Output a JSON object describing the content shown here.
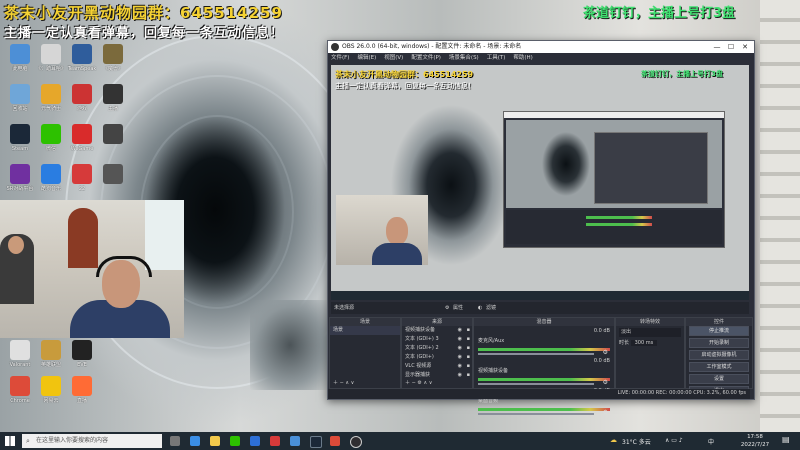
{
  "stream_overlay": {
    "line1": "茶末小友开黑动物园群：645514259",
    "line2": "主播一定认真看弹幕，回复每一条互动信息！",
    "top_right": "茶道钉钉，主播上号打3盘"
  },
  "desktop_icons": [
    {
      "label": "此电脑",
      "color": "#4d8fd6"
    },
    {
      "label": "《氵踏耳哈》",
      "color": "#d6d6d6"
    },
    {
      "label": "TeamSpeak",
      "color": "#2f5d9c"
    },
    {
      "label": "《魔兽》",
      "color": "#7b6a3c"
    },
    {
      "label": "回收站",
      "color": "#6fa6d8"
    },
    {
      "label": "元气骑士",
      "color": "#e6a72a"
    },
    {
      "label": "游戏",
      "color": "#cc3333"
    },
    {
      "label": "主播",
      "color": "#333333"
    },
    {
      "label": "Steam",
      "color": "#1b2838"
    },
    {
      "label": "微信",
      "color": "#2dc100"
    },
    {
      "label": "WeGame",
      "color": "#d92b2b"
    },
    {
      "label": "",
      "color": "#444444"
    },
    {
      "label": "SR对战平台",
      "color": "#7030a0"
    },
    {
      "label": "酷狗音乐",
      "color": "#2a7de1"
    },
    {
      "label": "22",
      "color": "#d63a3a"
    },
    {
      "label": "",
      "color": "#555555"
    }
  ],
  "bottom_icons": [
    {
      "label": "Valorant",
      "color": "#e0e0e0"
    },
    {
      "label": "英雄联盟",
      "color": "#c89b3c"
    },
    {
      "label": "EVE",
      "color": "#222222"
    },
    {
      "label": "Chrome",
      "color": "#dd4b39"
    },
    {
      "label": "网易云",
      "color": "#f1c40f"
    },
    {
      "label": "直播",
      "color": "#ff6b35"
    }
  ],
  "obs": {
    "title": "OBS 26.0.0 (64-bit, windows) - 配置文件: 未命名 - 场景: 未命名",
    "menu": [
      "文件(F)",
      "编辑(E)",
      "视图(V)",
      "配置文件(P)",
      "场景集合(S)",
      "工具(T)",
      "帮助(H)"
    ],
    "window_buttons": [
      "—",
      "☐",
      "✕"
    ],
    "source_label": "未选择源",
    "props_btn": "属性",
    "filter_btn": "滤镜",
    "scenes_header": "场景",
    "scenes": [
      "场景"
    ],
    "sources_header": "来源",
    "sources": [
      "视频捕获设备",
      "文本 (GDI+) 3",
      "文本 (GDI+) 2",
      "文本 (GDI+)",
      "VLC 视频源",
      "显示器捕获"
    ],
    "mixer_header": "混音器",
    "mixer": [
      {
        "name": "麦克风/Aux",
        "db": "0.0 dB"
      },
      {
        "name": "视频捕获设备",
        "db": "0.0 dB"
      },
      {
        "name": "桌面音频",
        "db": "0.0 dB"
      }
    ],
    "transitions_header": "转场特效",
    "transition_type": "淡出",
    "duration_label": "时长",
    "duration_value": "300 ms",
    "controls_header": "控件",
    "controls": [
      "停止推流",
      "开始录制",
      "启动虚拟摄像机",
      "工作室模式",
      "设置",
      "退出"
    ],
    "status": "LIVE: 00:00:00   REC: 00:00:00   CPU: 3.2%, 60.00 fps"
  },
  "taskbar": {
    "search_placeholder": "在这里输入你要搜索的内容",
    "clock_time": "17:58",
    "clock_date": "2022/7/27",
    "weather": "31°C 多云",
    "lang": "中"
  }
}
